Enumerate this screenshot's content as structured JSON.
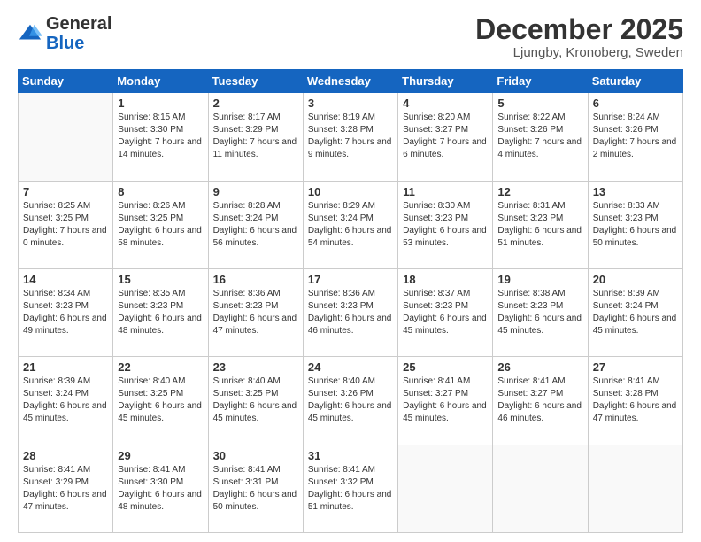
{
  "logo": {
    "general": "General",
    "blue": "Blue"
  },
  "header": {
    "month": "December 2025",
    "location": "Ljungby, Kronoberg, Sweden"
  },
  "weekdays": [
    "Sunday",
    "Monday",
    "Tuesday",
    "Wednesday",
    "Thursday",
    "Friday",
    "Saturday"
  ],
  "weeks": [
    [
      {
        "day": "",
        "sunrise": "",
        "sunset": "",
        "daylight": ""
      },
      {
        "day": "1",
        "sunrise": "Sunrise: 8:15 AM",
        "sunset": "Sunset: 3:30 PM",
        "daylight": "Daylight: 7 hours and 14 minutes."
      },
      {
        "day": "2",
        "sunrise": "Sunrise: 8:17 AM",
        "sunset": "Sunset: 3:29 PM",
        "daylight": "Daylight: 7 hours and 11 minutes."
      },
      {
        "day": "3",
        "sunrise": "Sunrise: 8:19 AM",
        "sunset": "Sunset: 3:28 PM",
        "daylight": "Daylight: 7 hours and 9 minutes."
      },
      {
        "day": "4",
        "sunrise": "Sunrise: 8:20 AM",
        "sunset": "Sunset: 3:27 PM",
        "daylight": "Daylight: 7 hours and 6 minutes."
      },
      {
        "day": "5",
        "sunrise": "Sunrise: 8:22 AM",
        "sunset": "Sunset: 3:26 PM",
        "daylight": "Daylight: 7 hours and 4 minutes."
      },
      {
        "day": "6",
        "sunrise": "Sunrise: 8:24 AM",
        "sunset": "Sunset: 3:26 PM",
        "daylight": "Daylight: 7 hours and 2 minutes."
      }
    ],
    [
      {
        "day": "7",
        "sunrise": "Sunrise: 8:25 AM",
        "sunset": "Sunset: 3:25 PM",
        "daylight": "Daylight: 7 hours and 0 minutes."
      },
      {
        "day": "8",
        "sunrise": "Sunrise: 8:26 AM",
        "sunset": "Sunset: 3:25 PM",
        "daylight": "Daylight: 6 hours and 58 minutes."
      },
      {
        "day": "9",
        "sunrise": "Sunrise: 8:28 AM",
        "sunset": "Sunset: 3:24 PM",
        "daylight": "Daylight: 6 hours and 56 minutes."
      },
      {
        "day": "10",
        "sunrise": "Sunrise: 8:29 AM",
        "sunset": "Sunset: 3:24 PM",
        "daylight": "Daylight: 6 hours and 54 minutes."
      },
      {
        "day": "11",
        "sunrise": "Sunrise: 8:30 AM",
        "sunset": "Sunset: 3:23 PM",
        "daylight": "Daylight: 6 hours and 53 minutes."
      },
      {
        "day": "12",
        "sunrise": "Sunrise: 8:31 AM",
        "sunset": "Sunset: 3:23 PM",
        "daylight": "Daylight: 6 hours and 51 minutes."
      },
      {
        "day": "13",
        "sunrise": "Sunrise: 8:33 AM",
        "sunset": "Sunset: 3:23 PM",
        "daylight": "Daylight: 6 hours and 50 minutes."
      }
    ],
    [
      {
        "day": "14",
        "sunrise": "Sunrise: 8:34 AM",
        "sunset": "Sunset: 3:23 PM",
        "daylight": "Daylight: 6 hours and 49 minutes."
      },
      {
        "day": "15",
        "sunrise": "Sunrise: 8:35 AM",
        "sunset": "Sunset: 3:23 PM",
        "daylight": "Daylight: 6 hours and 48 minutes."
      },
      {
        "day": "16",
        "sunrise": "Sunrise: 8:36 AM",
        "sunset": "Sunset: 3:23 PM",
        "daylight": "Daylight: 6 hours and 47 minutes."
      },
      {
        "day": "17",
        "sunrise": "Sunrise: 8:36 AM",
        "sunset": "Sunset: 3:23 PM",
        "daylight": "Daylight: 6 hours and 46 minutes."
      },
      {
        "day": "18",
        "sunrise": "Sunrise: 8:37 AM",
        "sunset": "Sunset: 3:23 PM",
        "daylight": "Daylight: 6 hours and 45 minutes."
      },
      {
        "day": "19",
        "sunrise": "Sunrise: 8:38 AM",
        "sunset": "Sunset: 3:23 PM",
        "daylight": "Daylight: 6 hours and 45 minutes."
      },
      {
        "day": "20",
        "sunrise": "Sunrise: 8:39 AM",
        "sunset": "Sunset: 3:24 PM",
        "daylight": "Daylight: 6 hours and 45 minutes."
      }
    ],
    [
      {
        "day": "21",
        "sunrise": "Sunrise: 8:39 AM",
        "sunset": "Sunset: 3:24 PM",
        "daylight": "Daylight: 6 hours and 45 minutes."
      },
      {
        "day": "22",
        "sunrise": "Sunrise: 8:40 AM",
        "sunset": "Sunset: 3:25 PM",
        "daylight": "Daylight: 6 hours and 45 minutes."
      },
      {
        "day": "23",
        "sunrise": "Sunrise: 8:40 AM",
        "sunset": "Sunset: 3:25 PM",
        "daylight": "Daylight: 6 hours and 45 minutes."
      },
      {
        "day": "24",
        "sunrise": "Sunrise: 8:40 AM",
        "sunset": "Sunset: 3:26 PM",
        "daylight": "Daylight: 6 hours and 45 minutes."
      },
      {
        "day": "25",
        "sunrise": "Sunrise: 8:41 AM",
        "sunset": "Sunset: 3:27 PM",
        "daylight": "Daylight: 6 hours and 45 minutes."
      },
      {
        "day": "26",
        "sunrise": "Sunrise: 8:41 AM",
        "sunset": "Sunset: 3:27 PM",
        "daylight": "Daylight: 6 hours and 46 minutes."
      },
      {
        "day": "27",
        "sunrise": "Sunrise: 8:41 AM",
        "sunset": "Sunset: 3:28 PM",
        "daylight": "Daylight: 6 hours and 47 minutes."
      }
    ],
    [
      {
        "day": "28",
        "sunrise": "Sunrise: 8:41 AM",
        "sunset": "Sunset: 3:29 PM",
        "daylight": "Daylight: 6 hours and 47 minutes."
      },
      {
        "day": "29",
        "sunrise": "Sunrise: 8:41 AM",
        "sunset": "Sunset: 3:30 PM",
        "daylight": "Daylight: 6 hours and 48 minutes."
      },
      {
        "day": "30",
        "sunrise": "Sunrise: 8:41 AM",
        "sunset": "Sunset: 3:31 PM",
        "daylight": "Daylight: 6 hours and 50 minutes."
      },
      {
        "day": "31",
        "sunrise": "Sunrise: 8:41 AM",
        "sunset": "Sunset: 3:32 PM",
        "daylight": "Daylight: 6 hours and 51 minutes."
      },
      {
        "day": "",
        "sunrise": "",
        "sunset": "",
        "daylight": ""
      },
      {
        "day": "",
        "sunrise": "",
        "sunset": "",
        "daylight": ""
      },
      {
        "day": "",
        "sunrise": "",
        "sunset": "",
        "daylight": ""
      }
    ]
  ]
}
